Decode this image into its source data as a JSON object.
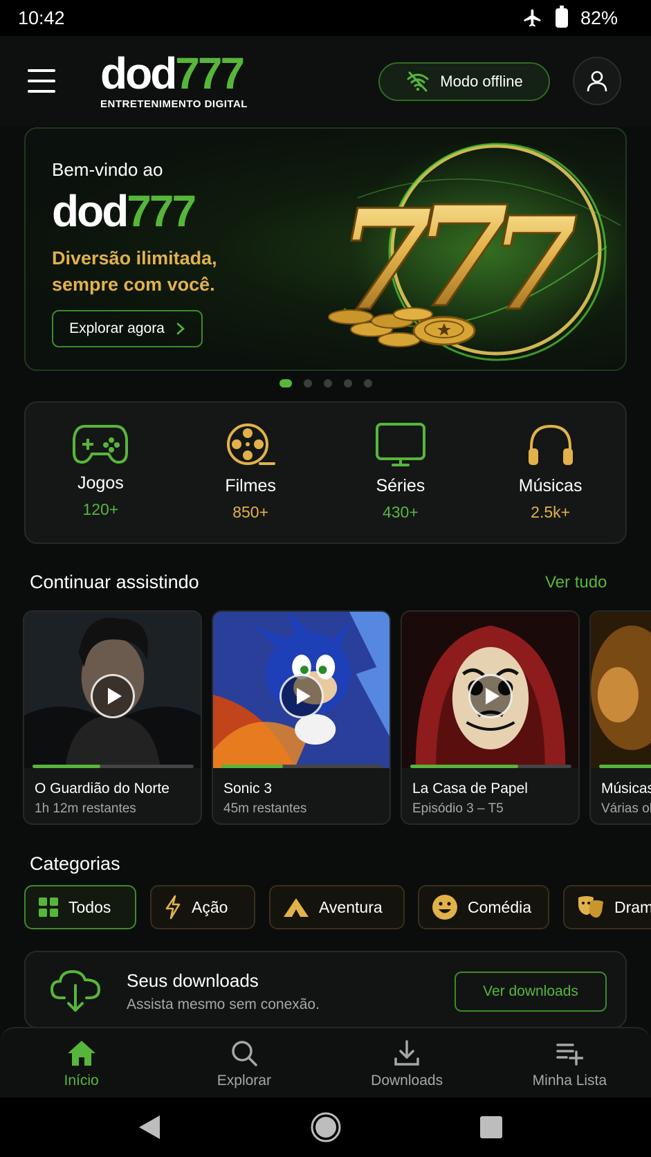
{
  "status_bar": {
    "time": "10:42",
    "battery": "82%"
  },
  "header": {
    "logo_white": "dod",
    "logo_green": "777",
    "logo_subtitle": "ENTRETENIMENTO DIGITAL",
    "offline_label": "Modo offline"
  },
  "hero": {
    "welcome": "Bem-vindo ao",
    "brand_white": "dod",
    "brand_green": "777",
    "tagline": "Diversão ilimitada, sempre com você.",
    "cta": "Explorar agora",
    "slides_total": 5,
    "active_slide": 1
  },
  "categories_summary": [
    {
      "label": "Jogos",
      "count": "120+",
      "icon": "gamepad-icon",
      "color": "#57b63a"
    },
    {
      "label": "Filmes",
      "count": "850+",
      "icon": "film-reel-icon",
      "color": "#e2b24a"
    },
    {
      "label": "Séries",
      "count": "430+",
      "icon": "tv-icon",
      "color": "#57b63a"
    },
    {
      "label": "Músicas",
      "count": "2.5k+",
      "icon": "headphones-icon",
      "color": "#e2b24a"
    }
  ],
  "continue_watching": {
    "title": "Continuar assistindo",
    "see_all": "Ver tudo",
    "items": [
      {
        "title": "O Guardião do Norte",
        "subtitle": "1h 12m restantes",
        "progress": 0.42
      },
      {
        "title": "Sonic 3",
        "subtitle": "45m restantes",
        "progress": 0.38
      },
      {
        "title": "La Casa de Papel",
        "subtitle": "Episódio 3 – T5",
        "progress": 0.67
      },
      {
        "title": "Músicas",
        "subtitle": "Várias ob",
        "progress": 0.5
      }
    ]
  },
  "categories": {
    "title": "Categorias",
    "chips": [
      {
        "label": "Todos",
        "icon": "grid-icon",
        "active": true
      },
      {
        "label": "Ação",
        "icon": "lightning-icon"
      },
      {
        "label": "Aventura",
        "icon": "mountain-icon"
      },
      {
        "label": "Comédia",
        "icon": "smile-icon"
      },
      {
        "label": "Drama",
        "icon": "theater-masks-icon"
      }
    ]
  },
  "downloads": {
    "title": "Seus downloads",
    "subtitle": "Assista mesmo sem conexão.",
    "button": "Ver downloads"
  },
  "bottom_nav": [
    {
      "label": "Início",
      "icon": "home-icon",
      "active": true
    },
    {
      "label": "Explorar",
      "icon": "search-icon"
    },
    {
      "label": "Downloads",
      "icon": "download-icon"
    },
    {
      "label": "Minha Lista",
      "icon": "playlist-add-icon"
    }
  ],
  "colors": {
    "accent_green": "#57b63a",
    "accent_gold": "#e2b24a",
    "background": "#0b0d0c"
  }
}
